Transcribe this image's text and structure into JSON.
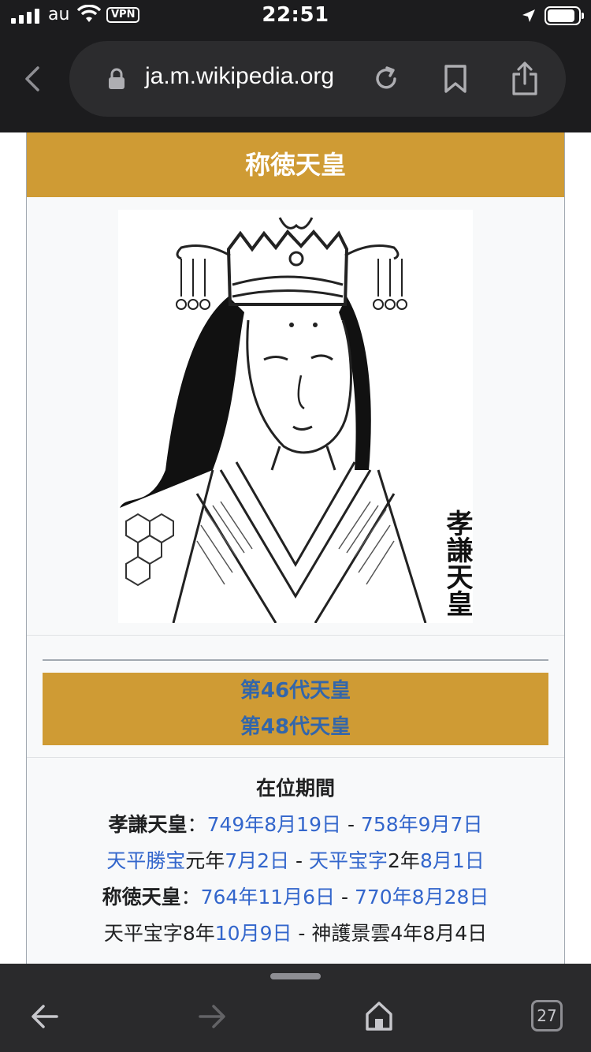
{
  "status_bar": {
    "carrier": "au",
    "vpn_label": "VPN",
    "time": "22:51",
    "battery_level": 0.9
  },
  "browser": {
    "url": "ja.m.wikipedia.org",
    "tab_count": "27"
  },
  "infobox": {
    "title": "称徳天皇",
    "title_color": "#cf9b34",
    "portrait_caption": "孝謙天皇",
    "prev_emperor": "第46代天皇",
    "next_emperor": "第48代天皇",
    "reign_heading": "在位期間",
    "reign": {
      "koken_name": "孝謙天皇",
      "colon": "：",
      "koken_start": "749年8月19日",
      "dash": " - ",
      "koken_end": "758年9月7日",
      "era1": "天平勝宝",
      "era1_year": "元年",
      "era1_date": "7月2日",
      "era2": "天平宝字",
      "era2_year": "2年",
      "era2_date": "8月1日",
      "shotoku_name": "称徳天皇",
      "shotoku_start": "764年11月6日",
      "shotoku_end": "770年8月28日",
      "era3_text": "天平宝字8年",
      "era3_date": "10月9日",
      "era4_text": "神護景雲4年8月4日"
    }
  }
}
